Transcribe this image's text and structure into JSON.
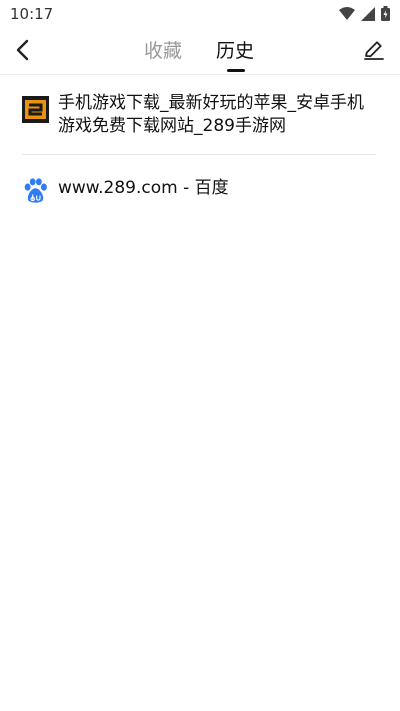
{
  "status": {
    "time": "10:17"
  },
  "tabs": {
    "favorites": "收藏",
    "history": "历史"
  },
  "history": [
    {
      "title": "手机游戏下载_最新好玩的苹果_安卓手机游戏免费下载网站_289手游网",
      "icon": "289-site-icon"
    },
    {
      "title": "www.289.com - 百度",
      "icon": "baidu-paw-icon"
    }
  ],
  "colors": {
    "active_tab": "#111111",
    "inactive_tab": "#9a9a9a",
    "baidu_blue": "#2f7cf6"
  }
}
